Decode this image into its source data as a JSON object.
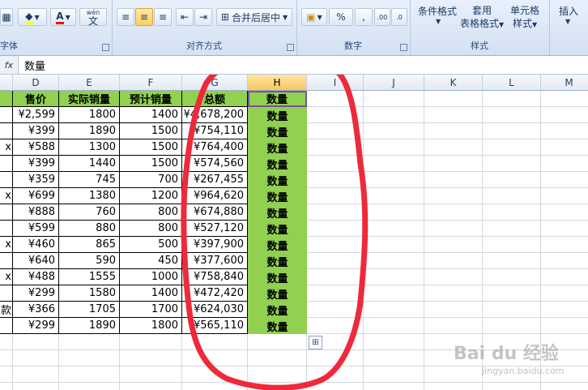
{
  "ribbon": {
    "font_group_label": "字体",
    "align_group_label": "对齐方式",
    "number_group_label": "数字",
    "style_group_label": "样式",
    "merge_label": "合并后居中",
    "percent_label": "%",
    "comma_label": ",",
    "conditional_format_label": "条件格式",
    "apply_label": "套用",
    "table_format_label": "表格格式",
    "cell_style_label": "单元格",
    "style_label": "样式",
    "insert_label": "插入",
    "wen_label": "wén",
    "wen_char": "文",
    "dec_inc": ".00",
    "dec_dec": ".0",
    "accent": "#92d050"
  },
  "formula_bar": {
    "fx_label": "fx",
    "value": "数量"
  },
  "columns": [
    "D",
    "E",
    "F",
    "G",
    "H",
    "I",
    "J",
    "K",
    "L",
    "M"
  ],
  "header_row": {
    "D": "售价",
    "E": "实际销量",
    "F": "预计销量",
    "G": "总额",
    "H": "数量"
  },
  "rows": [
    {
      "C": "",
      "D": "¥2,599",
      "E": "1800",
      "F": "1400",
      "G": "¥4,678,200",
      "H": "数量"
    },
    {
      "C": "",
      "D": "¥399",
      "E": "1890",
      "F": "1500",
      "G": "¥754,110",
      "H": "数量"
    },
    {
      "C": "x",
      "D": "¥588",
      "E": "1300",
      "F": "1500",
      "G": "¥764,400",
      "H": "数量"
    },
    {
      "C": "",
      "D": "¥399",
      "E": "1440",
      "F": "1500",
      "G": "¥574,560",
      "H": "数量"
    },
    {
      "C": "",
      "D": "¥359",
      "E": "745",
      "F": "700",
      "G": "¥267,455",
      "H": "数量"
    },
    {
      "C": "x",
      "D": "¥699",
      "E": "1380",
      "F": "1200",
      "G": "¥964,620",
      "H": "数量"
    },
    {
      "C": "",
      "D": "¥888",
      "E": "760",
      "F": "800",
      "G": "¥674,880",
      "H": "数量"
    },
    {
      "C": "",
      "D": "¥599",
      "E": "880",
      "F": "800",
      "G": "¥527,120",
      "H": "数量"
    },
    {
      "C": "x",
      "D": "¥460",
      "E": "865",
      "F": "500",
      "G": "¥397,900",
      "H": "数量"
    },
    {
      "C": "",
      "D": "¥640",
      "E": "590",
      "F": "450",
      "G": "¥377,600",
      "H": "数量"
    },
    {
      "C": "x",
      "D": "¥488",
      "E": "1555",
      "F": "1000",
      "G": "¥758,840",
      "H": "数量"
    },
    {
      "C": "",
      "D": "¥299",
      "E": "1580",
      "F": "1400",
      "G": "¥472,420",
      "H": "数量"
    },
    {
      "C": "款",
      "D": "¥366",
      "E": "1705",
      "F": "1700",
      "G": "¥624,030",
      "H": "数量"
    },
    {
      "C": "",
      "D": "¥299",
      "E": "1890",
      "F": "1800",
      "G": "¥565,110",
      "H": "数量"
    }
  ],
  "watermark": {
    "brand": "Bai du 经验",
    "url": "jingyan.baidu.com"
  }
}
